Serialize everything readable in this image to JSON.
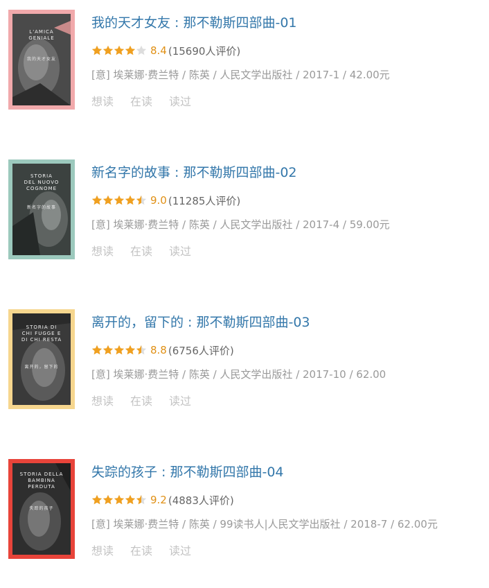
{
  "books": [
    {
      "title": "我的天才女友 : 那不勒斯四部曲-01",
      "rating": 8.4,
      "score": "8.4",
      "stars": 4,
      "votes": "(15690人评价)",
      "pub": "[意] 埃莱娜·费兰特 / 陈英 / 人民文学出版社 / 2017-1 / 42.00元",
      "cover": {
        "frame_color": "#f1a9ab",
        "lines": "L'AMICA\nGENIALE",
        "cn": "我的天才女友"
      }
    },
    {
      "title": "新名字的故事 : 那不勒斯四部曲-02",
      "rating": 9.0,
      "score": "9.0",
      "stars": 4.5,
      "votes": "(11285人评价)",
      "pub": "[意] 埃莱娜·费兰特 / 陈英 / 人民文学出版社 / 2017-4 / 59.00元",
      "cover": {
        "frame_color": "#9cc9bd",
        "lines": "STORIA\nDEL NUOVO\nCOGNOME",
        "cn": "新名字的故事"
      }
    },
    {
      "title": "离开的，留下的 : 那不勒斯四部曲-03",
      "rating": 8.8,
      "score": "8.8",
      "stars": 4.5,
      "votes": "(6756人评价)",
      "pub": "[意] 埃莱娜·费兰特 / 陈英 / 人民文学出版社 / 2017-10 / 62.00",
      "cover": {
        "frame_color": "#f6d68e",
        "lines": "STORIA DI\nCHI FUGGE E\nDI CHI RESTA",
        "cn": "离开的，留下的"
      }
    },
    {
      "title": "失踪的孩子 : 那不勒斯四部曲-04",
      "rating": 9.2,
      "score": "9.2",
      "stars": 4.5,
      "votes": "(4883人评价)",
      "pub": "[意] 埃莱娜·费兰特 / 陈英 / 99读书人|人民文学出版社 / 2018-7 / 62.00元",
      "cover": {
        "frame_color": "#e8443a",
        "lines": "STORIA DELLA\nBAMBINA\nPERDUTA",
        "cn": "失踪的孩子"
      }
    }
  ],
  "actions": [
    "想读",
    "在读",
    "读过"
  ],
  "colors": {
    "link": "#3377aa",
    "star": "#f0a020",
    "star_empty": "#dddddd",
    "score": "#e09015",
    "meta": "#999999",
    "action": "#c3c3c3"
  }
}
